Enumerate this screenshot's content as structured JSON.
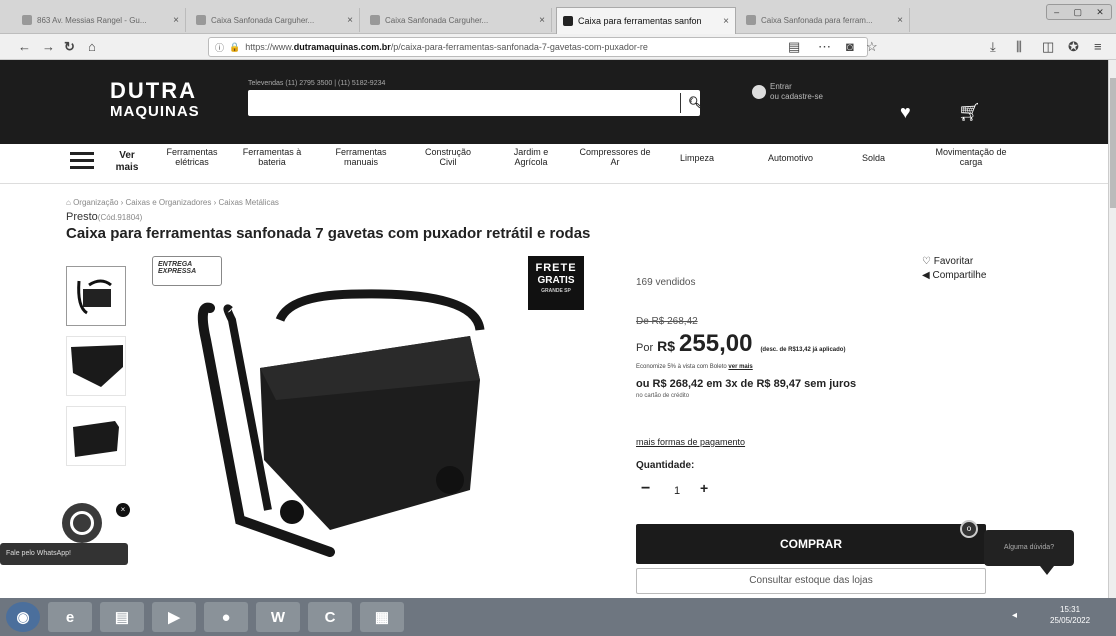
{
  "browser": {
    "tabs": [
      {
        "label": "863 Av. Messias Rangel - Gu..."
      },
      {
        "label": "Caixa Sanfonada Carguher..."
      },
      {
        "label": "Caixa Sanfonada Carguher..."
      },
      {
        "label": "Caixa para ferramentas sanfon"
      },
      {
        "label": "Caixa Sanfonada para ferram..."
      }
    ],
    "window_buttons": [
      "–",
      "▢",
      "✕"
    ],
    "url_prefix": "https://www.",
    "url_domain": "dutramaquinas.com.br",
    "url_path": "/p/caixa-para-ferramentas-sanfonada-7-gavetas-com-puxador-re"
  },
  "site": {
    "logo_line1": "DUTRA",
    "logo_line2": "MAQUINAS",
    "phones": "Televendas (11) 2795 3500  |  (11) 5182-9234",
    "account_line1": "Entrar",
    "account_line2": "ou cadastre-se",
    "menu_label": "Ver mais",
    "categories": [
      "Ferramentas elétricas",
      "Ferramentas à bateria",
      "Ferramentas manuais",
      "Construção Civil",
      "Jardim e Agrícola",
      "Compressores de Ar",
      "Limpeza",
      "Automotivo",
      "Solda",
      "Movimentação de carga"
    ]
  },
  "product": {
    "breadcrumb": "Organização › Caixas e Organizadores › Caixas Metálicas",
    "brand": "Presto",
    "code": "(Cód.91804)",
    "title": "Caixa para ferramentas sanfonada 7 gavetas com puxador retrátil e rodas",
    "express_line1": "ENTREGA",
    "express_line2": "EXPRESSA",
    "frete_line1": "FRETE",
    "frete_line2": "GRATIS",
    "frete_line3": "GRANDE SP",
    "favorite": "Favoritar",
    "share": "Compartilhe",
    "sold": "169 vendidos",
    "old_price": "De R$ 268,42",
    "price_prefix": "Por",
    "currency": "R$",
    "price": "255,00",
    "discount_note": "(desc. de R$13,42 já aplicado)",
    "boleto_text": "Economize 5% à vista com Boleto",
    "boleto_link": "ver mais",
    "installments": "ou R$ 268,42 em 3x de R$ 89,47 sem juros",
    "installments_note": "no cartão de crédito",
    "more_payments": "mais formas de pagamento",
    "quantity_label": "Quantidade:",
    "quantity_minus": "−",
    "quantity_value": "1",
    "quantity_plus": "+",
    "buy_button": "COMPRAR",
    "stock_button": "Consultar estoque das lojas"
  },
  "widgets": {
    "chat_bubble": "Alguma dúvida?",
    "chat_dot": "o",
    "whatsapp_label": "Fale pelo WhatsApp!",
    "whatsapp_close": "×"
  },
  "taskbar": {
    "time": "15:31",
    "date": "25/05/2022"
  },
  "colors": {
    "header_bg": "#1c1c1c",
    "buy_bg": "#1b1b1b",
    "taskbar_bg": "#6e7680"
  }
}
